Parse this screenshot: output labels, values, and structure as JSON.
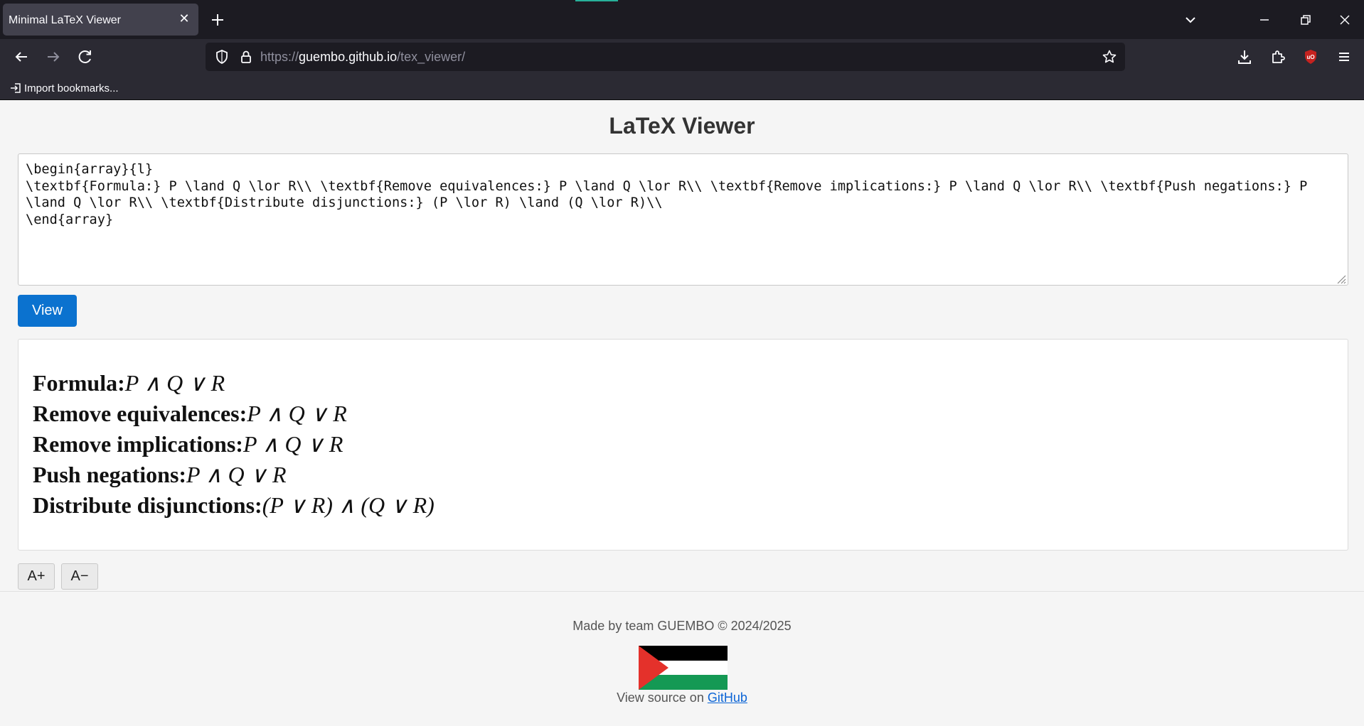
{
  "browser": {
    "tab": {
      "title": "Minimal LaTeX Viewer",
      "close": "✕"
    },
    "new_tab": "+",
    "url": {
      "scheme": "https://",
      "host": "guembo.github.io",
      "path": "/tex_viewer/"
    },
    "bookmarks": {
      "import_label": "Import bookmarks..."
    },
    "colors": {
      "chrome_dark": "#1c1b22",
      "chrome_toolbar": "#2b2a33",
      "tab_active": "#42414d",
      "accent": "#27b09a",
      "ublock": "#c5221f"
    }
  },
  "page": {
    "title": "LaTeX Viewer",
    "input_value": "\\begin{array}{l}\n\\textbf{Formula:} P \\land Q \\lor R\\\\ \\textbf{Remove equivalences:} P \\land Q \\lor R\\\\ \\textbf{Remove implications:} P \\land Q \\lor R\\\\ \\textbf{Push negations:} P \\land Q \\lor R\\\\ \\textbf{Distribute disjunctions:} (P \\lor R) \\land (Q \\lor R)\\\\\n\\end{array}",
    "view_button": "View",
    "output": [
      {
        "label": "Formula:",
        "math": "P ∧ Q ∨ R"
      },
      {
        "label": "Remove equivalences:",
        "math": "P ∧ Q ∨ R"
      },
      {
        "label": "Remove implications:",
        "math": "P ∧ Q ∨ R"
      },
      {
        "label": "Push negations:",
        "math": "P ∧ Q ∨ R"
      },
      {
        "label": "Distribute disjunctions:",
        "math": "(P ∨ R) ∧ (Q ∨ R)"
      }
    ],
    "font_increase": "A+",
    "font_decrease": "A−",
    "colors": {
      "view_button": "#0b72cf",
      "link": "#0b64d6"
    }
  },
  "footer": {
    "credit": "Made by team GUEMBO © 2024/2025",
    "source_prefix": "View source on",
    "source_link": "GitHub",
    "flag_colors": {
      "black": "#000000",
      "white": "#ffffff",
      "green": "#149954",
      "red": "#e4312b"
    }
  }
}
